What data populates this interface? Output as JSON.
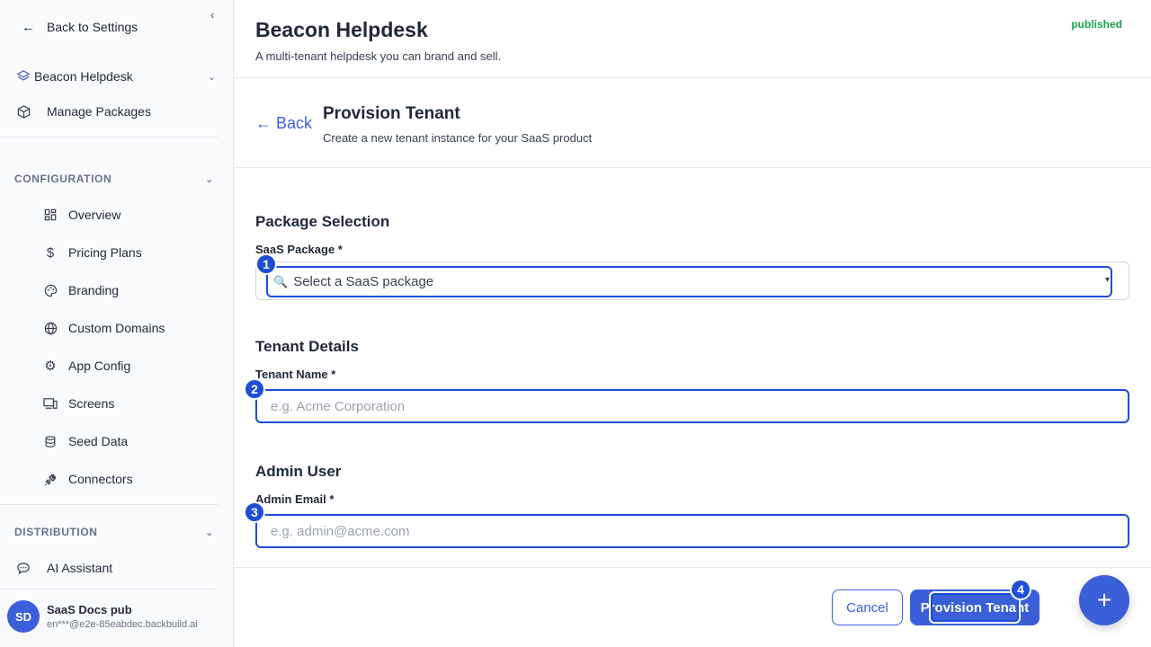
{
  "sidebar": {
    "back_label": "Back to Settings",
    "project": "Beacon Helpdesk",
    "manage_packages": "Manage Packages",
    "configuration_label": "CONFIGURATION",
    "config_items": [
      {
        "label": "Overview",
        "icon": "grid-icon"
      },
      {
        "label": "Pricing Plans",
        "icon": "dollar-icon"
      },
      {
        "label": "Branding",
        "icon": "palette-icon"
      },
      {
        "label": "Custom Domains",
        "icon": "globe-icon"
      },
      {
        "label": "App Config",
        "icon": "gear-icon"
      },
      {
        "label": "Screens",
        "icon": "devices-icon"
      },
      {
        "label": "Seed Data",
        "icon": "database-icon"
      },
      {
        "label": "Connectors",
        "icon": "plug-icon"
      }
    ],
    "distribution_label": "DISTRIBUTION",
    "ai_assistant": "AI Assistant",
    "user": {
      "initials": "SD",
      "name": "SaaS Docs pub",
      "email": "en***@e2e-85eabdec.backbuild.ai"
    }
  },
  "header": {
    "title": "Beacon Helpdesk",
    "subtitle": "A multi-tenant helpdesk you can brand and sell.",
    "status": "published",
    "status_color": "#16a34a"
  },
  "page": {
    "back_label": "← Back",
    "title": "Provision Tenant",
    "subtitle": "Create a new tenant instance for your SaaS product"
  },
  "form": {
    "package_section": "Package Selection",
    "package_label": "SaaS Package *",
    "package_placeholder": "Select a SaaS package",
    "tenant_section": "Tenant Details",
    "tenant_label": "Tenant Name *",
    "tenant_placeholder": "e.g. Acme Corporation",
    "admin_section": "Admin User",
    "admin_label": "Admin Email *",
    "admin_placeholder": "e.g. admin@acme.com"
  },
  "actions": {
    "cancel": "Cancel",
    "submit": "Provision Tenant",
    "fab": "+"
  },
  "badges": [
    "1",
    "2",
    "3",
    "4"
  ],
  "accent_color": "#3b5fd8"
}
